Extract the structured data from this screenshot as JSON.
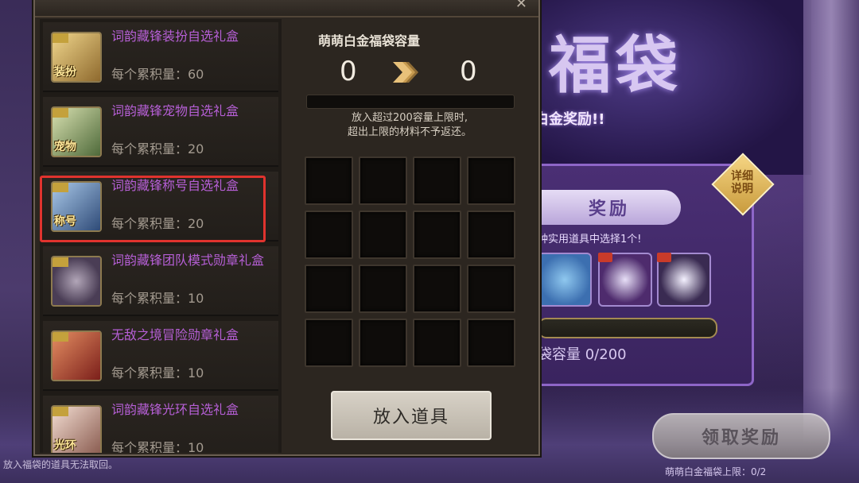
{
  "background": {
    "banner_title": "福袋",
    "banner_subtitle": "白金奖励!!",
    "diamond_label": "详细说明",
    "reward_tab_label": "奖励",
    "reward_note": "种实用道具中选择1个!",
    "reward_capacity": "袋容量 0/200",
    "claim_button_label": "领取奖励",
    "claim_note": "萌萌白金福袋上限：0/2",
    "bottom_tip": "放入福袋的道具无法取回。"
  },
  "items": [
    {
      "name": "词韵藏锋装扮自选礼盒",
      "cost": "每个累积量：60",
      "tag": "装扮",
      "color": "#c9a46b"
    },
    {
      "name": "词韵藏锋宠物自选礼盒",
      "cost": "每个累积量：20",
      "tag": "宠物",
      "color": "#6b8a5a"
    },
    {
      "name": "词韵藏锋称号自选礼盒",
      "cost": "每个累积量：20",
      "tag": "称号",
      "color": "#4d6fa0"
    },
    {
      "name": "词韵藏锋团队模式勋章礼盒",
      "cost": "每个累积量：10",
      "tag": "",
      "color": "#6d5c73"
    },
    {
      "name": "无敌之境冒险勋章礼盒",
      "cost": "每个累积量：10",
      "tag": "",
      "color": "#a33a2f"
    },
    {
      "name": "词韵藏锋光环自选礼盒",
      "cost": "每个累积量：10",
      "tag": "光环",
      "color": "#c29a8a"
    }
  ],
  "capacity": {
    "title": "萌萌白金福袋容量",
    "current": "0",
    "after": "0",
    "fill_fraction": 0,
    "note_line1": "放入超过200容量上限时,",
    "note_line2": "超出上限的材料不予返还。"
  },
  "slots_count": 16,
  "put_button_label": "放入道具"
}
